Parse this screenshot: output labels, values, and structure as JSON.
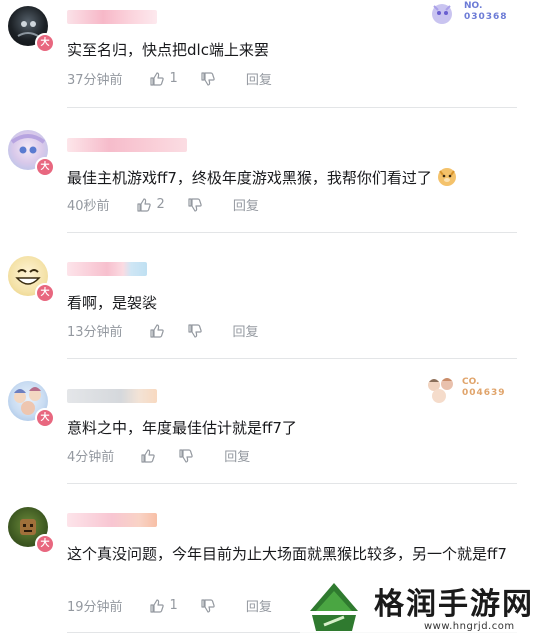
{
  "comments": [
    {
      "text": "实至名归，快点把dlc端上来罢",
      "time": "37分钟前",
      "likes": "1",
      "reply_label": "回复",
      "badge_prefix": "NO.",
      "badge_number": "030368",
      "level": "大"
    },
    {
      "text": "最佳主机游戏ff7，终极年度游戏黑猴，我帮你们看过了",
      "time": "40秒前",
      "likes": "2",
      "reply_label": "回复",
      "level": "大"
    },
    {
      "text": "看啊，是袈裟",
      "time": "13分钟前",
      "likes": "",
      "reply_label": "回复",
      "level": "大"
    },
    {
      "text": "意料之中，年度最佳估计就是ff7了",
      "time": "4分钟前",
      "likes": "",
      "reply_label": "回复",
      "badge_prefix": "CO.",
      "badge_number": "004639",
      "level": "大"
    },
    {
      "text": "这个真没问题，今年目前为止大场面就黑猴比较多，另一个就是ff7",
      "time": "19分钟前",
      "likes": "1",
      "reply_label": "回复",
      "level": "大"
    }
  ],
  "watermark": {
    "brand": "格润手游网",
    "url": "www.hngrjd.com"
  },
  "colors": {
    "level_badge": "#e8677f",
    "meta_gray": "#9499a0",
    "divider": "#e3e5e7"
  }
}
